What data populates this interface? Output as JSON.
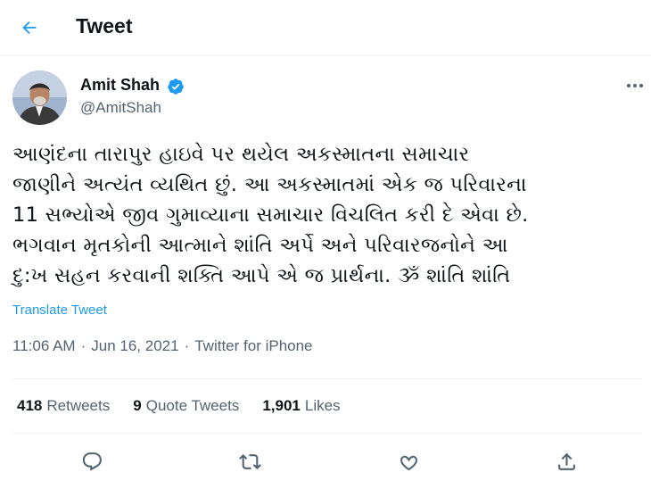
{
  "header": {
    "title": "Tweet",
    "back_icon": "arrow-left-icon"
  },
  "author": {
    "name": "Amit Shah",
    "handle": "@AmitShah",
    "verified_icon": "verified-badge-icon"
  },
  "more_icon": "more-horizontal-icon",
  "tweet": {
    "lines": [
      "આણંદના તારાપુર હાઇવે પર થયેલ અકસ્માતના સમાચાર",
      "જાણીને અત્યંત વ્યથિત છું. આ અકસ્માતમાં એક જ પરિવારના",
      "11 સભ્યોએ જીવ ગુમાવ્યાના સમાચાર વિચલિત કરી દે એવા છે.",
      "ભગવાન મૃતકોની આત્માને શાંતિ અર્પે અને પરિવારજનોને આ",
      "દુ:ખ સહન કરવાની શક્તિ આપે એ જ પ્રાર્થના. ૐ શાંતિ શાંતિ"
    ],
    "translate_label": "Translate Tweet"
  },
  "meta": {
    "time": "11:06 AM",
    "sep1": "·",
    "date": "Jun 16, 2021",
    "sep2": "·",
    "source": "Twitter for iPhone"
  },
  "stats": {
    "retweets": {
      "count": "418",
      "label": "Retweets"
    },
    "quotes": {
      "count": "9",
      "label": "Quote Tweets"
    },
    "likes": {
      "count": "1,901",
      "label": "Likes"
    }
  },
  "actions": [
    "reply-icon",
    "retweet-icon",
    "like-icon",
    "share-icon"
  ],
  "colors": {
    "accent": "#1d9bf0",
    "text": "#0f1419",
    "secondary": "#536471",
    "border": "#eff3f4"
  }
}
